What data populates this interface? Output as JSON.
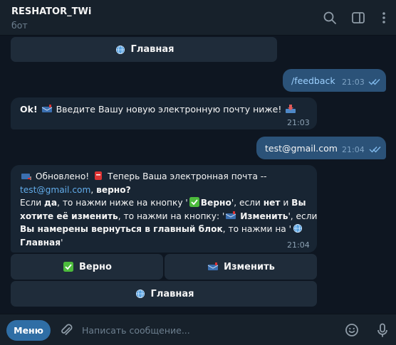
{
  "header": {
    "title": "RESHATOR_TWi",
    "status": "бот",
    "icons": [
      "search-icon",
      "sidebar-toggle-icon",
      "more-vertical-icon"
    ]
  },
  "messages": {
    "feedback_cmd": {
      "text": "/feedback",
      "time": "21:03"
    },
    "ok_prompt": {
      "ok": "Ok!",
      "text": "Введите Вашу новую электронную почту ниже!",
      "time": "21:03"
    },
    "email_sent": {
      "text": "test@gmail.com",
      "time": "21:04"
    },
    "updated": {
      "p1": "Обновлено!",
      "p2": "Теперь Ваша электронная почта --",
      "email": "test@gmail.com",
      "p3": ",",
      "verno_q": "верно?",
      "l3a": "Если",
      "da": "да",
      "l3b": ", то нажми ниже на кнопку '",
      "verno": "Верно",
      "l3c": "', если",
      "net": "нет",
      "l3d": "и",
      "vy": "Вы",
      "l4a": "хотите её изменить",
      "l4b": ", то нажми на кнопку: '",
      "izmenit": "Изменить",
      "l4c": "', если",
      "l5a": "Вы намерены вернуться в главный блок",
      "l5b": ", то нажми на '",
      "glavnaya": "Главная",
      "end": "'",
      "time": "21:04"
    }
  },
  "keyboard": {
    "top_main": "Главная",
    "verno": "Верно",
    "izmenit": "Изменить",
    "main": "Главная"
  },
  "footer": {
    "menu": "Меню",
    "placeholder": "Написать сообщение..."
  },
  "colors": {
    "background": "#0e1621",
    "header": "#17212b",
    "incoming": "#182533",
    "outgoing": "#2b5278",
    "link": "#62acea",
    "accent": "#2f6ea5"
  }
}
